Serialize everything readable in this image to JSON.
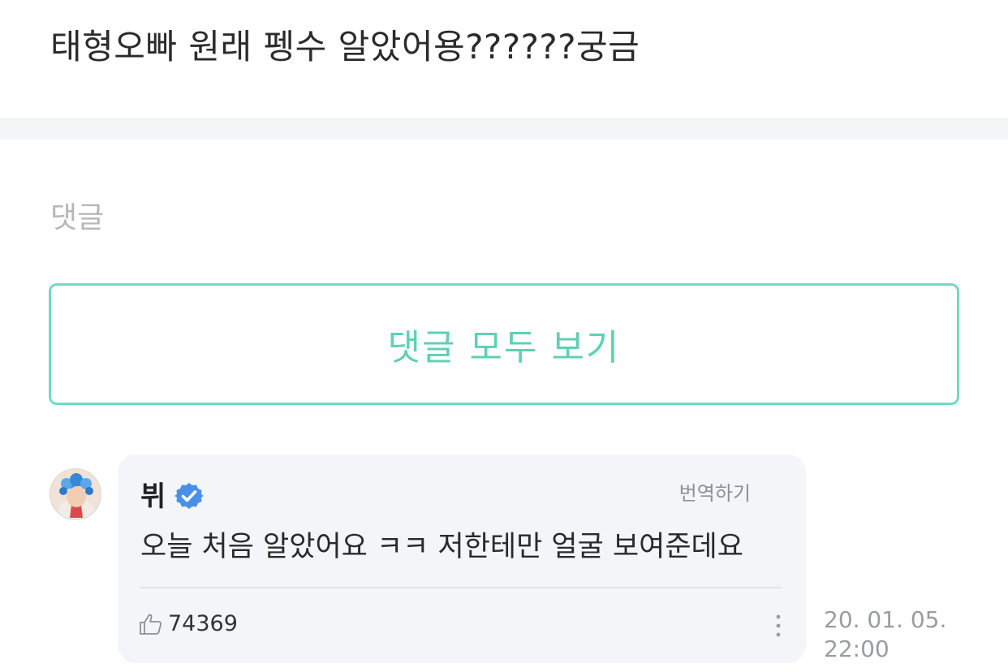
{
  "post": {
    "title": "태형오빠 원래 펭수 알았어용??????궁금"
  },
  "comments_section": {
    "heading": "댓글",
    "view_all_label": "댓글 모두 보기"
  },
  "comment": {
    "author": "뷔",
    "verified_icon": "verified-check-icon",
    "translate_label": "번역하기",
    "text": "오늘 처음 알았어요 ㅋㅋ 저한테만 얼굴 보여준데요",
    "like_icon": "thumbs-up-icon",
    "like_count": "74369",
    "more_icon": "more-vertical-icon",
    "timestamp": "20. 01. 05. 22:00"
  },
  "colors": {
    "accent": "#5fd0b5",
    "accent_border": "#73d9c4",
    "verified": "#4a90e8",
    "card_bg": "#f4f5f9",
    "divider_bg": "#f4f5f7"
  }
}
